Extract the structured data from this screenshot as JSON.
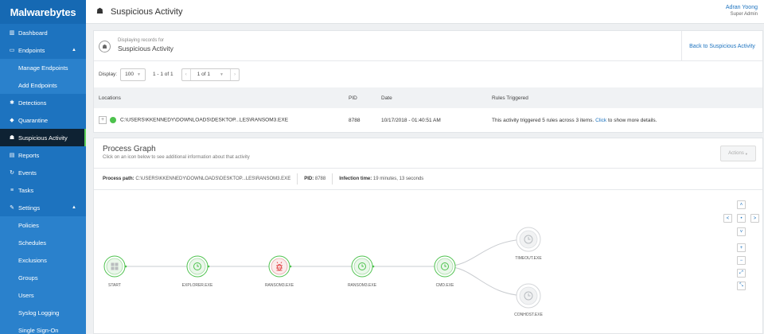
{
  "brand": {
    "logo_text": "Malwarebytes"
  },
  "sidebar": {
    "items": [
      {
        "label": "Dashboard",
        "icon": "bar-chart-icon",
        "glyph": "▥"
      },
      {
        "label": "Endpoints",
        "icon": "monitor-icon",
        "glyph": "▭"
      },
      {
        "label": "Manage Endpoints"
      },
      {
        "label": "Add Endpoints"
      },
      {
        "label": "Detections",
        "icon": "bug-icon",
        "glyph": "✱"
      },
      {
        "label": "Quarantine",
        "icon": "shield-icon",
        "glyph": "◆"
      },
      {
        "label": "Suspicious Activity",
        "icon": "hazmat-icon",
        "glyph": "☗"
      },
      {
        "label": "Reports",
        "icon": "report-icon",
        "glyph": "▤"
      },
      {
        "label": "Events",
        "icon": "refresh-icon",
        "glyph": "↻"
      },
      {
        "label": "Tasks",
        "icon": "list-icon",
        "glyph": "≡"
      },
      {
        "label": "Settings",
        "icon": "wrench-icon",
        "glyph": "✎"
      },
      {
        "label": "Policies"
      },
      {
        "label": "Schedules"
      },
      {
        "label": "Exclusions"
      },
      {
        "label": "Groups"
      },
      {
        "label": "Users"
      },
      {
        "label": "Syslog Logging"
      },
      {
        "label": "Single Sign-On"
      }
    ]
  },
  "header": {
    "title": "Suspicious Activity",
    "user_name": "Adran Yoong",
    "user_role": "Super Admin"
  },
  "records": {
    "displaying_label": "Displaying records for",
    "subtitle": "Suspicious Activity",
    "back_link": "Back to Suspicious Activity",
    "display_label": "Display:",
    "page_size": "100",
    "range": "1 - 1 of 1",
    "page": "1 of 1",
    "columns": [
      "Locations",
      "PID",
      "Date",
      "Rules Triggered"
    ],
    "row": {
      "location": "C:\\USERS\\KKENNEDY\\DOWNLOADS\\DESKTOP...LES\\RANSOM3.EXE",
      "pid": "8788",
      "date": "10/17/2018 - 01:40:51 AM",
      "rules_pre": "This activity triggered 5 rules across 3 items.",
      "rules_link": "Click",
      "rules_post": "to show more details."
    }
  },
  "process_graph": {
    "title": "Process Graph",
    "subtitle": "Click on an icon below to see additional information about that activity",
    "actions_label": "Actions",
    "path_label": "Process path:",
    "path_value": "C:\\USERS\\KKENNEDY\\DOWNLOADS\\DESKTOP...LES\\RANSOM3.EXE",
    "pid_label": "PID:",
    "pid_value": "8788",
    "infection_label": "Infection time:",
    "infection_value": "19 minutes, 13 seconds",
    "nodes": [
      "START",
      "EXPLORER.EXE",
      "RANSOM3.EXE",
      "RANSOM3.EXE",
      "CMD.EXE",
      "TIMEOUT.EXE",
      "CONHOST.EXE"
    ]
  },
  "graph_controls": {
    "up": "˄",
    "left": "<",
    "center": "•",
    "right": ">",
    "down": "˅",
    "zoom_in": "+",
    "zoom_out": "−",
    "expand": "⤢",
    "shrink": "⤡"
  },
  "colors": {
    "sidebar": "#1d73bf",
    "active": "#0e2233",
    "green": "#4dc24d",
    "red": "#e04848",
    "link": "#1d73bf"
  }
}
